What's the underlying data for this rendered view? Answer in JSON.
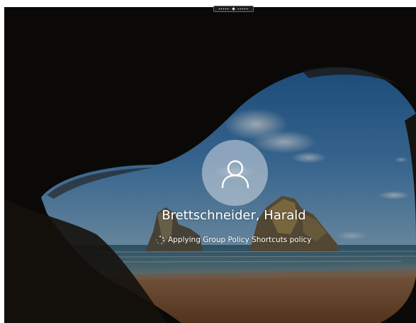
{
  "lock_screen": {
    "user_name": "Brettschneider, Harald",
    "status_text": "Applying Group Policy Shortcuts policy",
    "avatar_icon": "user-icon",
    "spinner_icon": "loading-spinner-icon"
  },
  "remote_bar": {
    "pin_icon": "pin-icon",
    "signal_icon": "connection-bars-icon",
    "menu_icon": "menu-dots-icon"
  },
  "colors": {
    "sky": "#3b78b4",
    "sea": "#3f6f86",
    "sand": "#a06a3e",
    "cave": "#0d0b09"
  }
}
